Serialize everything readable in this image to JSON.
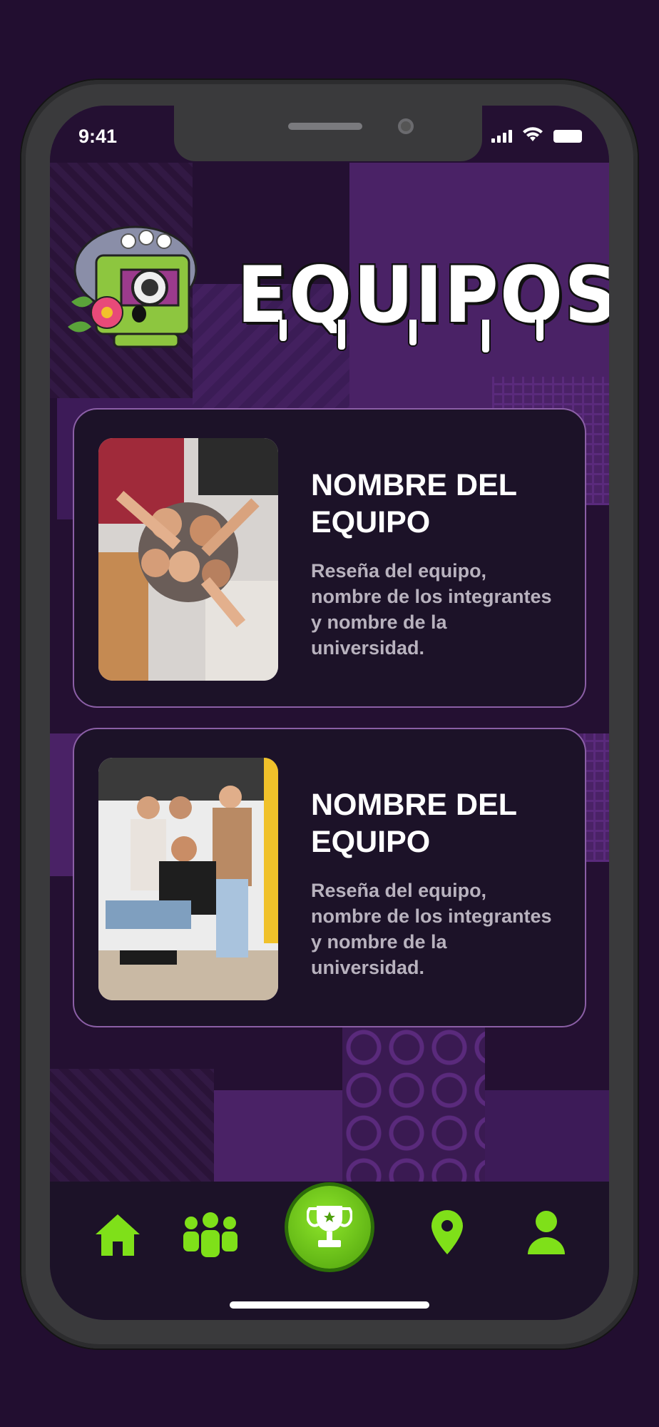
{
  "status": {
    "time": "9:41"
  },
  "header": {
    "title": "EQUIPOS"
  },
  "teams": [
    {
      "name": "NOMBRE DEL EQUIPO",
      "description": "Reseña del equipo, nombre de los integrantes y nombre de la universidad."
    },
    {
      "name": "NOMBRE DEL EQUIPO",
      "description": "Reseña del equipo, nombre de los integrantes y nombre de la universidad."
    }
  ],
  "nav": {
    "items": [
      "home-icon",
      "team-icon",
      "trophy-icon",
      "location-pin-icon",
      "profile-icon"
    ],
    "active": "trophy-icon"
  },
  "colors": {
    "accent": "#7fe019",
    "background": "#220e30",
    "card": "#1c1228",
    "card_border": "#8b5fa6"
  }
}
